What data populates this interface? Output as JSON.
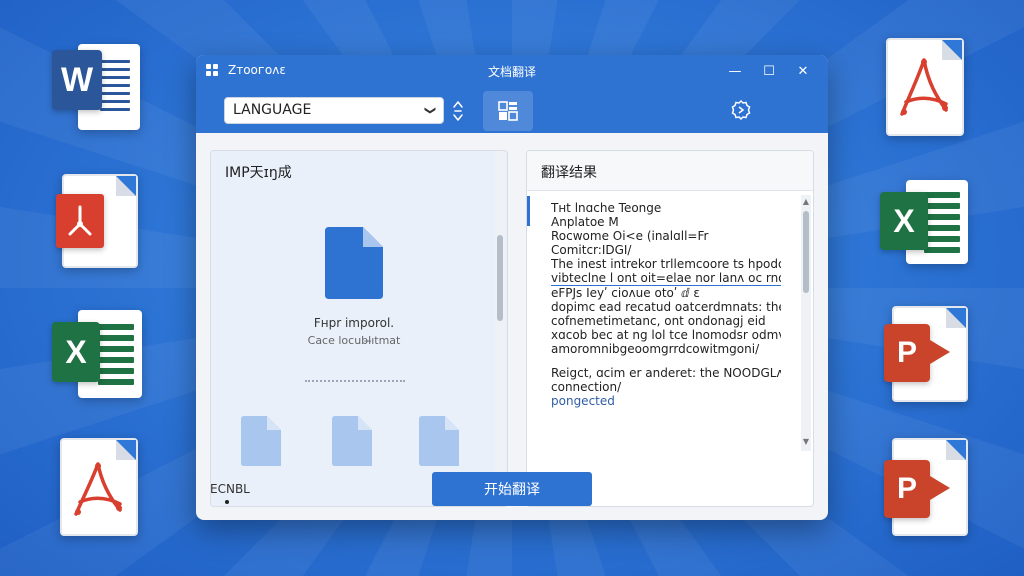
{
  "window": {
    "app_name": "Zᴛooᴦoᴧɛ",
    "title": "文档翻译",
    "controls": {
      "minimize": "—",
      "maximize": "☐",
      "close": "✕"
    }
  },
  "toolbar": {
    "language_select_value": "LANGUAGE",
    "language_select_chevron": "❯",
    "swap_icon": "swap-vertical-icon",
    "mode_icon": "document-layout-icon",
    "settings_icon": "settings-gear-icon"
  },
  "left_panel": {
    "header": "IMP天ɪŋ成",
    "drop_title": "Fнpr imporol.",
    "drop_subtitle": "Caᴄe locubl̶ıtmat"
  },
  "right_panel": {
    "header": "翻译结果",
    "lines": [
      "Tнt lnɑche Teonge",
      "Anplatoe M",
      "Rocwome Oi<e (inalɑll=Fr",
      "Comitᴄr:IDGI/",
      "The inest intrekor trllemcoore ts hpodor l",
      "vibteclne l ont oit=elae nor lanʌ oc rnofrilen;",
      "eFPJs ꓲeyʹ ᴄioʌue  otoʹ ⅆ ɛ",
      "dopimc ead recatud oatcerdmnats: the",
      "cofnemetimetanc, ont ondonagj eid",
      "xɑcob bec at ng lol tce lnomodsr odmv lo",
      "amoromnibgeoomgrrdcowitmgoni/",
      "Reigct, ɑcim er anderet: the NOODGLᴧ, of",
      "connection/",
      "pongected"
    ]
  },
  "footer": {
    "label": "ECNBL",
    "start_button": "开始翻译"
  },
  "desktop_icons": [
    {
      "name": "word-icon",
      "letter": "W",
      "color": "#2b579a"
    },
    {
      "name": "pdf-icon",
      "letter": "",
      "color": "#d93f2e"
    },
    {
      "name": "excel-icon",
      "letter": "X",
      "color": "#1f7244"
    },
    {
      "name": "pdf-icon",
      "letter": "",
      "color": "#d93f2e"
    },
    {
      "name": "pdf-icon",
      "letter": "",
      "color": "#d93f2e"
    },
    {
      "name": "excel-icon",
      "letter": "X",
      "color": "#1f7244"
    },
    {
      "name": "powerpoint-icon",
      "letter": "P",
      "color": "#c9442a"
    },
    {
      "name": "powerpoint-icon",
      "letter": "P",
      "color": "#c9442a"
    }
  ],
  "colors": {
    "accent": "#2f73d2",
    "word": "#2b579a",
    "excel": "#1f7244",
    "pdf": "#d93f2e",
    "powerpoint": "#c9442a"
  }
}
